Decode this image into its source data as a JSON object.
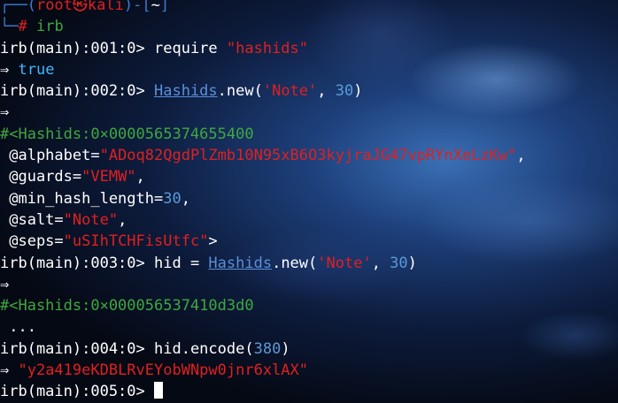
{
  "prompt_header": {
    "top_frame": "┌──(",
    "user": "root",
    "separator_icon": "㉿",
    "host": "kali",
    "mid_frame": ")-[",
    "cwd": "~",
    "end_frame": "]",
    "bottom_frame": "└─",
    "hash": "#",
    "command": "irb"
  },
  "lines": {
    "l1_prompt": "irb(main):001:0> ",
    "l1_code": "require ",
    "l1_str": "\"hashids\"",
    "l2_arrow": "⇒ ",
    "l2_val": "true",
    "l3_prompt": "irb(main):002:0> ",
    "l3_const": "Hashids",
    "l3_call": ".new(",
    "l3_str": "'Note'",
    "l3_comma": ", ",
    "l3_num": "30",
    "l3_close": ")",
    "l4_arrow": "⇒",
    "l5_obj": "#<Hashids:0×0000565374655400",
    "l6_attr": " @alphabet=",
    "l6_str": "\"ADoq82QgdPlZmb10N95xB6O3kyjraJG47vpRYnXeLzKw\"",
    "l6_end": ",",
    "l7_attr": " @guards=",
    "l7_str": "\"VEMW\"",
    "l7_end": ",",
    "l8_attr": " @min_hash_length=",
    "l8_num": "30",
    "l8_end": ",",
    "l9_attr": " @salt=",
    "l9_str": "\"Note\"",
    "l9_end": ",",
    "l10_attr": " @seps=",
    "l10_str": "\"uSIhTCHFisUtfc\"",
    "l10_end": ">",
    "l11_prompt": "irb(main):003:0> ",
    "l11_code": "hid = ",
    "l11_const": "Hashids",
    "l11_call": ".new(",
    "l11_str": "'Note'",
    "l11_comma": ", ",
    "l11_num": "30",
    "l11_close": ")",
    "l12_arrow": "⇒",
    "l13_obj": "#<Hashids:0×000056537410d3d0",
    "l14_ellipsis": " ...",
    "l15_prompt": "irb(main):004:0> ",
    "l15_code": "hid.encode(",
    "l15_num": "380",
    "l15_close": ")",
    "l16_arrow": "⇒ ",
    "l16_str": "\"y2a419eKDBLRvEYobWNpw0jnr6xlAX\"",
    "l17_prompt": "irb(main):005:0> "
  }
}
